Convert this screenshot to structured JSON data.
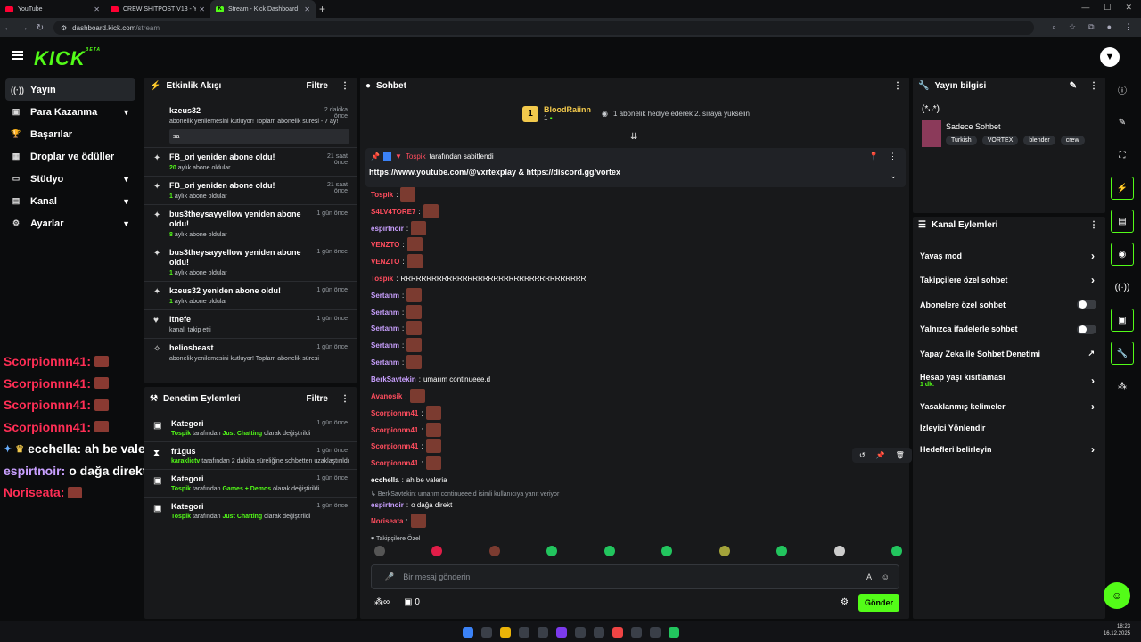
{
  "browser": {
    "tabs": [
      {
        "title": "YouTube",
        "icon": "youtube"
      },
      {
        "title": "CREW SHITPOST V13 - YouTube",
        "icon": "youtube"
      },
      {
        "title": "Stream - Kick Dashboard",
        "icon": "kick"
      }
    ],
    "url_host": "dashboard.kick.com",
    "url_path": "/stream"
  },
  "logo": "KICK",
  "logo_beta": "BETA",
  "nav": [
    {
      "label": "Yayın",
      "icon": "broadcast-icon"
    },
    {
      "label": "Para Kazanma",
      "icon": "wallet-icon"
    },
    {
      "label": "Başarılar",
      "icon": "trophy-icon"
    },
    {
      "label": "Droplar ve ödüller",
      "icon": "gift-icon"
    },
    {
      "label": "Stüdyo",
      "icon": "studio-icon"
    },
    {
      "label": "Kanal",
      "icon": "channel-icon"
    },
    {
      "label": "Ayarlar",
      "icon": "settings-icon"
    }
  ],
  "overlay_chat": [
    {
      "user": "Scorpionnn41:",
      "color": "#ff2e55"
    },
    {
      "user": "Scorpionnn41:",
      "color": "#ff2e55"
    },
    {
      "user": "Scorpionnn41:",
      "color": "#ff2e55"
    },
    {
      "user": "Scorpionnn41:",
      "color": "#ff2e55"
    },
    {
      "user": "ecchella:",
      "text": "ah be valeria",
      "color": "#ffffff"
    },
    {
      "user": "espirtnoir:",
      "text": "o dağa direkt",
      "color": "#c9a0ff"
    },
    {
      "user": "Noriseata:",
      "color": "#ff2e55"
    }
  ],
  "activity": {
    "title": "Etkinlik Akışı",
    "filter": "Filtre",
    "items": [
      {
        "title": "kzeus32",
        "time": "2 dakika önce",
        "sub": "abonelik yenilemesini kutluyor! Toplam abonelik süresi - 7 ay!",
        "box": "sa"
      },
      {
        "title": "FB_ori yeniden abone oldu!",
        "time": "21 saat önce",
        "count": "20",
        "sub": "aylık abone oldular"
      },
      {
        "title": "FB_ori yeniden abone oldu!",
        "time": "21 saat önce",
        "count": "1",
        "sub": "aylık abone oldular"
      },
      {
        "title": "bus3theysayyellow yeniden abone oldu!",
        "time": "1 gün önce",
        "count": "8",
        "sub": "aylık abone oldular"
      },
      {
        "title": "bus3theysayyellow yeniden abone oldu!",
        "time": "1 gün önce",
        "count": "1",
        "sub": "aylık abone oldular"
      },
      {
        "title": "kzeus32 yeniden abone oldu!",
        "time": "1 gün önce",
        "count": "1",
        "sub": "aylık abone oldular"
      },
      {
        "title": "itnefe",
        "time": "1 gün önce",
        "sub": "kanalı takip etti"
      },
      {
        "title": "heliosbeast",
        "time": "1 gün önce",
        "sub": "abonelik yenilemesini kutluyor! Toplam abonelik süresi"
      }
    ]
  },
  "moderation": {
    "title": "Denetim Eylemleri",
    "filter": "Filtre",
    "items": [
      {
        "title": "Kategori",
        "time": "1 gün önce",
        "who": "Tospik",
        "mid": "tarafından",
        "what": "Just Chatting",
        "end": "olarak değiştirildi"
      },
      {
        "title": "fr1gus",
        "time": "1 gün önce",
        "who": "karaklictv",
        "mid": "tarafından 2 dakika süreliğine sohbetten",
        "what": "",
        "end": "uzaklaştırıldı"
      },
      {
        "title": "Kategori",
        "time": "1 gün önce",
        "who": "Tospik",
        "mid": "tarafından",
        "what": "Games + Demos",
        "end": "olarak değiştirildi"
      },
      {
        "title": "Kategori",
        "time": "1 gün önce",
        "who": "Tospik",
        "mid": "tarafından",
        "what": "Just Chatting",
        "end": "olarak değiştirildi"
      }
    ]
  },
  "chat": {
    "title": "Sohbet",
    "gifter": "BloodRaiinn",
    "gifter_rank": "1",
    "gifter_count": "1",
    "gift_msg": "1 abonelik hediye ederek 2. sıraya yükselin",
    "pinned_by": "Tospik",
    "pinned_label": "tarafından sabitlendi",
    "pinned_link1": "https://www.youtube.com/@vxrtexplay",
    "pinned_amp": "&",
    "pinned_link2": "https://discord.gg/vortex",
    "messages": [
      {
        "user": "Tospik",
        "text": "",
        "cls": "red"
      },
      {
        "user": "S4LV4TORE7",
        "text": "",
        "cls": "red"
      },
      {
        "user": "espirtnoir",
        "text": "",
        "cls": "purple"
      },
      {
        "user": "VENZTO",
        "text": "",
        "cls": "red"
      },
      {
        "user": "VENZTO",
        "text": "",
        "cls": "red"
      },
      {
        "user": "Tospik",
        "text": "RRRRRRRRRRRRRRRRRRRRRRRRRRRRRRRRRRRR,",
        "cls": "red"
      },
      {
        "user": "Sertanm",
        "text": "",
        "cls": "purple"
      },
      {
        "user": "Sertanm",
        "text": "",
        "cls": "purple"
      },
      {
        "user": "Sertanm",
        "text": "",
        "cls": "purple"
      },
      {
        "user": "Sertanm",
        "text": "",
        "cls": "purple"
      },
      {
        "user": "Sertanm",
        "text": "",
        "cls": "purple"
      },
      {
        "user": "BerkSavtekin",
        "text": "umarım continueee.d",
        "cls": "purple"
      },
      {
        "user": "Avanosik",
        "text": "",
        "cls": "red"
      },
      {
        "user": "Scorpionnn41",
        "text": "",
        "cls": "red"
      },
      {
        "user": "Scorpionnn41",
        "text": "",
        "cls": "red"
      },
      {
        "user": "Scorpionnn41",
        "text": "",
        "cls": "red"
      },
      {
        "user": "Scorpionnn41",
        "text": "",
        "cls": "red"
      },
      {
        "user": "ecchella",
        "text": "ah be valeria",
        "cls": "white"
      }
    ],
    "reply_note": "BerkSavtekin: umarım continueee.d isimli kullanıcıya yanıt veriyor",
    "reply_user": "espirtnoir",
    "reply_text": "o dağa direkt",
    "last_user": "Noriseata",
    "followers_only": "Takipçilere Özel",
    "input_placeholder": "Bir mesaj gönderin",
    "points": "0",
    "send": "Gönder"
  },
  "stream_info": {
    "title": "Yayın bilgisi",
    "kaomoji": "(*ᴗ*)",
    "stream_title": "Sadece Sohbet",
    "tags": [
      "Turkish",
      "VORTEX",
      "blender",
      "crew"
    ]
  },
  "channel_actions": {
    "title": "Kanal Eylemleri",
    "items": [
      {
        "label": "Yavaş mod",
        "type": "arrow"
      },
      {
        "label": "Takipçilere özel sohbet",
        "type": "arrow"
      },
      {
        "label": "Abonelere özel sohbet",
        "type": "toggle"
      },
      {
        "label": "Yalnızca ifadelerle sohbet",
        "type": "toggle"
      },
      {
        "label": "Yapay Zeka ile Sohbet Denetimi",
        "type": "ext"
      },
      {
        "label": "Hesap yaşı kısıtlaması",
        "sub": "1 dk.",
        "type": "arrow"
      },
      {
        "label": "Yasaklanmış kelimeler",
        "type": "arrow"
      },
      {
        "label": "İzleyici Yönlendir",
        "type": "none"
      },
      {
        "label": "Hedefleri belirleyin",
        "type": "arrow"
      }
    ]
  },
  "clock": {
    "time": "18:23",
    "date": "16.12.2025"
  }
}
